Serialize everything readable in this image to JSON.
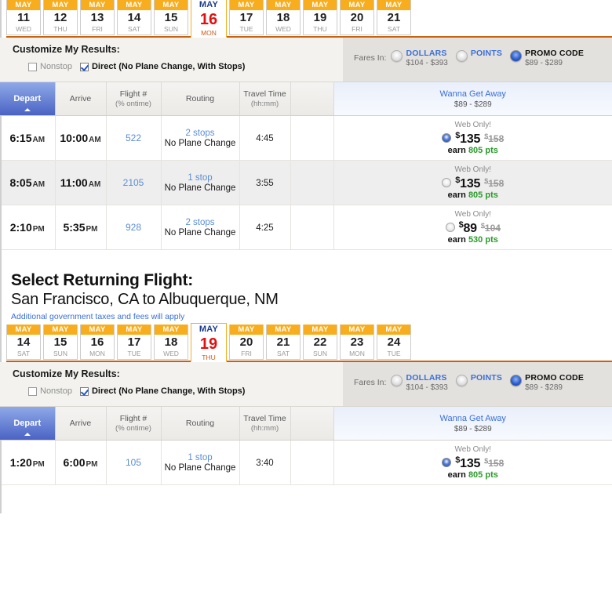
{
  "outbound": {
    "date_strip": [
      {
        "month": "MAY",
        "day": "11",
        "dow": "WED",
        "selected": false
      },
      {
        "month": "MAY",
        "day": "12",
        "dow": "THU",
        "selected": false
      },
      {
        "month": "MAY",
        "day": "13",
        "dow": "FRI",
        "selected": false
      },
      {
        "month": "MAY",
        "day": "14",
        "dow": "SAT",
        "selected": false
      },
      {
        "month": "MAY",
        "day": "15",
        "dow": "SUN",
        "selected": false
      },
      {
        "month": "MAY",
        "day": "16",
        "dow": "MON",
        "selected": true
      },
      {
        "month": "MAY",
        "day": "17",
        "dow": "TUE",
        "selected": false
      },
      {
        "month": "MAY",
        "day": "18",
        "dow": "WED",
        "selected": false
      },
      {
        "month": "MAY",
        "day": "19",
        "dow": "THU",
        "selected": false
      },
      {
        "month": "MAY",
        "day": "20",
        "dow": "FRI",
        "selected": false
      },
      {
        "month": "MAY",
        "day": "21",
        "dow": "SAT",
        "selected": false
      }
    ],
    "customize": {
      "title": "Customize My Results:",
      "nonstop_label": "Nonstop",
      "nonstop_checked": false,
      "direct_label": "Direct (No Plane Change, With Stops)",
      "direct_checked": true,
      "fares_in_label": "Fares In:",
      "fare_options": [
        {
          "label": "DOLLARS",
          "range": "$104 - $393",
          "selected": false
        },
        {
          "label": "POINTS",
          "range": "",
          "selected": false
        },
        {
          "label": "PROMO CODE",
          "range": "$89 - $289",
          "selected": true
        }
      ]
    },
    "columns": {
      "depart": "Depart",
      "arrive": "Arrive",
      "flight_no": "Flight #",
      "flight_no_sub": "(% ontime)",
      "routing": "Routing",
      "travel_time": "Travel Time",
      "travel_time_sub": "(hh:mm)",
      "fare_class": "Wanna Get Away",
      "fare_range": "$89 - $289"
    },
    "flights": [
      {
        "depart_time": "6:15",
        "depart_mer": "AM",
        "arrive_time": "10:00",
        "arrive_mer": "AM",
        "flight_no": "522",
        "stops": "2 stops",
        "plane_change": "No Plane Change",
        "travel_time": "4:45",
        "web_only": "Web Only!",
        "price": "135",
        "price_strike": "158",
        "earn_prefix": "earn",
        "earn_points": "805 pts",
        "selected": true
      },
      {
        "depart_time": "8:05",
        "depart_mer": "AM",
        "arrive_time": "11:00",
        "arrive_mer": "AM",
        "flight_no": "2105",
        "stops": "1 stop",
        "plane_change": "No Plane Change",
        "travel_time": "3:55",
        "web_only": "Web Only!",
        "price": "135",
        "price_strike": "158",
        "earn_prefix": "earn",
        "earn_points": "805 pts",
        "selected": false
      },
      {
        "depart_time": "2:10",
        "depart_mer": "PM",
        "arrive_time": "5:35",
        "arrive_mer": "PM",
        "flight_no": "928",
        "stops": "2 stops",
        "plane_change": "No Plane Change",
        "travel_time": "4:25",
        "web_only": "Web Only!",
        "price": "89",
        "price_strike": "104",
        "earn_prefix": "earn",
        "earn_points": "530 pts",
        "selected": false
      }
    ]
  },
  "returning": {
    "heading": "Select Returning Flight:",
    "route": "San Francisco, CA to Albuquerque, NM",
    "note": "Additional government taxes and fees will apply",
    "date_strip": [
      {
        "month": "MAY",
        "day": "14",
        "dow": "SAT",
        "selected": false
      },
      {
        "month": "MAY",
        "day": "15",
        "dow": "SUN",
        "selected": false
      },
      {
        "month": "MAY",
        "day": "16",
        "dow": "MON",
        "selected": false
      },
      {
        "month": "MAY",
        "day": "17",
        "dow": "TUE",
        "selected": false
      },
      {
        "month": "MAY",
        "day": "18",
        "dow": "WED",
        "selected": false
      },
      {
        "month": "MAY",
        "day": "19",
        "dow": "THU",
        "selected": true
      },
      {
        "month": "MAY",
        "day": "20",
        "dow": "FRI",
        "selected": false
      },
      {
        "month": "MAY",
        "day": "21",
        "dow": "SAT",
        "selected": false
      },
      {
        "month": "MAY",
        "day": "22",
        "dow": "SUN",
        "selected": false
      },
      {
        "month": "MAY",
        "day": "23",
        "dow": "MON",
        "selected": false
      },
      {
        "month": "MAY",
        "day": "24",
        "dow": "TUE",
        "selected": false
      }
    ],
    "customize": {
      "title": "Customize My Results:",
      "nonstop_label": "Nonstop",
      "nonstop_checked": false,
      "direct_label": "Direct (No Plane Change, With Stops)",
      "direct_checked": true,
      "fares_in_label": "Fares In:",
      "fare_options": [
        {
          "label": "DOLLARS",
          "range": "$104 - $393",
          "selected": false
        },
        {
          "label": "POINTS",
          "range": "",
          "selected": false
        },
        {
          "label": "PROMO CODE",
          "range": "$89 - $289",
          "selected": true
        }
      ]
    },
    "columns": {
      "depart": "Depart",
      "arrive": "Arrive",
      "flight_no": "Flight #",
      "flight_no_sub": "(% ontime)",
      "routing": "Routing",
      "travel_time": "Travel Time",
      "travel_time_sub": "(hh:mm)",
      "fare_class": "Wanna Get Away",
      "fare_range": "$89 - $289"
    },
    "flights": [
      {
        "depart_time": "1:20",
        "depart_mer": "PM",
        "arrive_time": "6:00",
        "arrive_mer": "PM",
        "flight_no": "105",
        "stops": "1 stop",
        "plane_change": "No Plane Change",
        "travel_time": "3:40",
        "web_only": "Web Only!",
        "price": "135",
        "price_strike": "158",
        "earn_prefix": "earn",
        "earn_points": "805 pts",
        "selected": true
      }
    ]
  },
  "colors": {
    "accent_orange": "#f7ad1e",
    "rule_orange": "#c8620f",
    "link_blue": "#3a6fd8",
    "selected_day_red": "#e01010",
    "points_green": "#2a9a2a",
    "depart_header": "#4a63c4"
  }
}
